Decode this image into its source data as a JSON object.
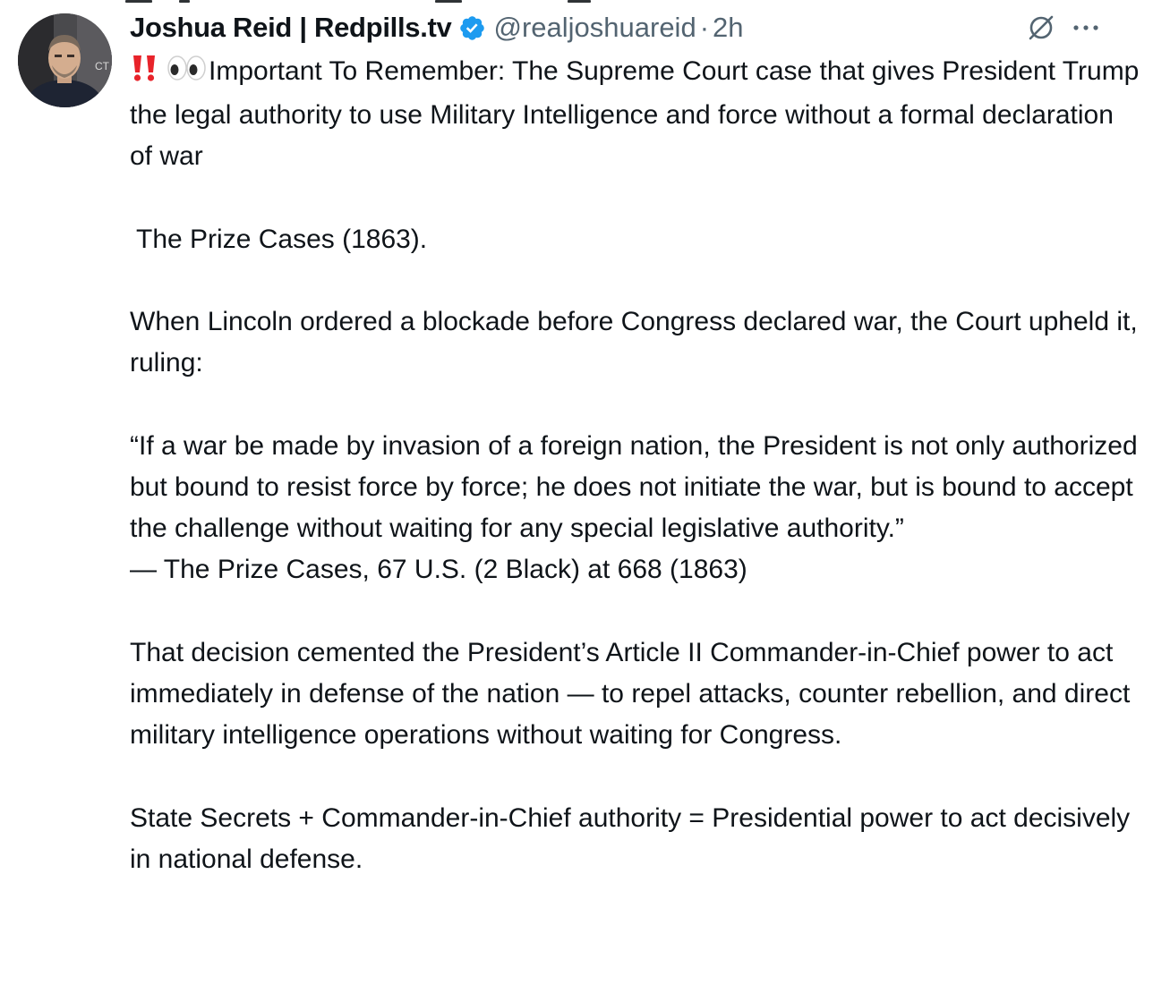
{
  "author": {
    "display_name": "Joshua Reid | Redpills.tv",
    "handle": "@realjoshuareid",
    "separator": "·",
    "time": "2h",
    "verified": true,
    "avatar_shirt_text": "CT"
  },
  "actions": {
    "grok_icon": "grok-slash-circle-icon",
    "more_icon": "more-dots-icon"
  },
  "tweet": {
    "emoji_prefix": [
      "double-exclamation-emoji",
      "eyes-emoji"
    ],
    "line1": "Important To Remember: The Supreme Court case that gives President Trump the legal authority to use Military Intelligence and force without a formal declaration of war",
    "line2": "The Prize Cases (1863).",
    "line3": "When Lincoln ordered a blockade before Congress declared war, the Court upheld it, ruling:",
    "quote": "“If a war be made by invasion of a foreign nation, the President is not only authorized but bound to resist force by force; he does not initiate the war, but is bound to accept the challenge without waiting for any special legislative authority.”",
    "citation": "— The Prize Cases, 67 U.S. (2 Black) at 668 (1863)",
    "line4": "That decision cemented the President’s Article II Commander-in-Chief power to act immediately in defense of the nation — to repel attacks, counter rebellion, and direct military intelligence operations without waiting for Congress.",
    "line5": "State Secrets + Commander-in-Chief authority = Presidential power to act decisively in national defense."
  },
  "colors": {
    "text": "#0f1419",
    "secondary": "#536471",
    "verified_badge": "#1d9bf0",
    "emoji_red": "#e8232a"
  }
}
